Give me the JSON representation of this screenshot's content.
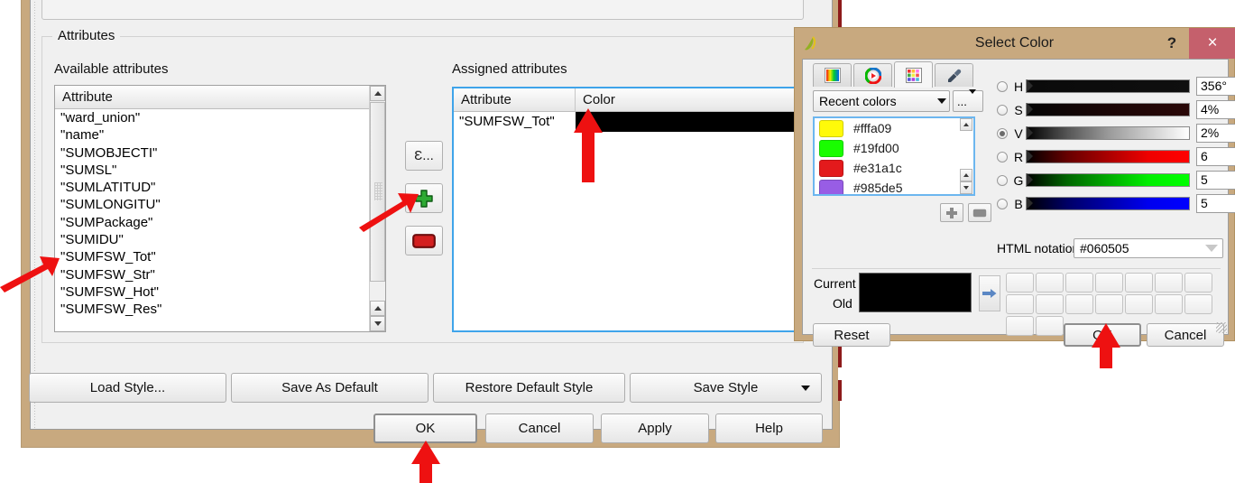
{
  "main_dialog": {
    "group_title": "Attributes",
    "available_label": "Available attributes",
    "assigned_label": "Assigned attributes",
    "available_column_header": "Attribute",
    "available_items": [
      "\"ward_union\"",
      "\"name\"",
      "\"SUMOBJECTI\"",
      "\"SUMSL\"",
      "\"SUMLATITUD\"",
      "\"SUMLONGITU\"",
      "\"SUMPackage\"",
      "\"SUMIDU\"",
      "\"SUMFSW_Tot\"",
      "\"SUMFSW_Str\"",
      "\"SUMFSW_Hot\"",
      "\"SUMFSW_Res\""
    ],
    "assigned_columns": [
      "Attribute",
      "Color"
    ],
    "assigned_rows": [
      {
        "attribute": "\"SUMFSW_Tot\"",
        "color": "#000000"
      }
    ],
    "tool_buttons": [
      {
        "name": "expression",
        "label": "Ɛ..."
      },
      {
        "name": "add",
        "label": ""
      },
      {
        "name": "remove",
        "label": ""
      }
    ],
    "style_buttons": [
      "Load Style...",
      "Save As Default",
      "Restore Default Style",
      "Save Style"
    ],
    "action_buttons": [
      "OK",
      "Cancel",
      "Apply",
      "Help"
    ]
  },
  "color_dialog": {
    "title": "Select Color",
    "help_label": "?",
    "close_label": "×",
    "tabs": [
      {
        "name": "color-ramp-tab",
        "icon": "gradient-image-icon"
      },
      {
        "name": "color-wheel-tab",
        "icon": "color-wheel-icon"
      },
      {
        "name": "color-swatches-tab",
        "icon": "palette-icon",
        "active": true
      },
      {
        "name": "color-picker-tab",
        "icon": "eyedropper-icon"
      }
    ],
    "palette_select": "Recent colors",
    "palette_menu_label": "...",
    "recent_colors": [
      {
        "hex": "#fffa09",
        "label": "#fffa09"
      },
      {
        "hex": "#19fd00",
        "label": "#19fd00"
      },
      {
        "hex": "#e31a1c",
        "label": "#e31a1c"
      },
      {
        "hex": "#985de5",
        "label": "#985de5"
      }
    ],
    "channels": [
      {
        "key": "H",
        "value": "356°",
        "selected": false
      },
      {
        "key": "S",
        "value": "4%",
        "selected": false
      },
      {
        "key": "V",
        "value": "2%",
        "selected": true
      },
      {
        "key": "R",
        "value": "6",
        "selected": false
      },
      {
        "key": "G",
        "value": "5",
        "selected": false
      },
      {
        "key": "B",
        "value": "5",
        "selected": false
      }
    ],
    "html_notation_label": "HTML notation",
    "html_notation_value": "#060505",
    "current_label": "Current",
    "old_label": "Old",
    "current_color": "#000000",
    "old_color": "#000000",
    "custom_swatch_slots": 16,
    "reset_label": "Reset",
    "ok_label": "OK",
    "cancel_label": "Cancel"
  },
  "annotations": {
    "color": "#ee1111",
    "arrows": [
      {
        "name": "arrow-available-sumfsw-tot",
        "points_to": "\"SUMFSW_Tot\" list item"
      },
      {
        "name": "arrow-add-button",
        "points_to": "green add attribute button"
      },
      {
        "name": "arrow-assigned-color-cell",
        "points_to": "black color cell"
      },
      {
        "name": "arrow-main-ok-button",
        "points_to": "OK button of style dialog"
      },
      {
        "name": "arrow-color-ok-button",
        "points_to": "OK button of Select Color dialog"
      }
    ]
  }
}
